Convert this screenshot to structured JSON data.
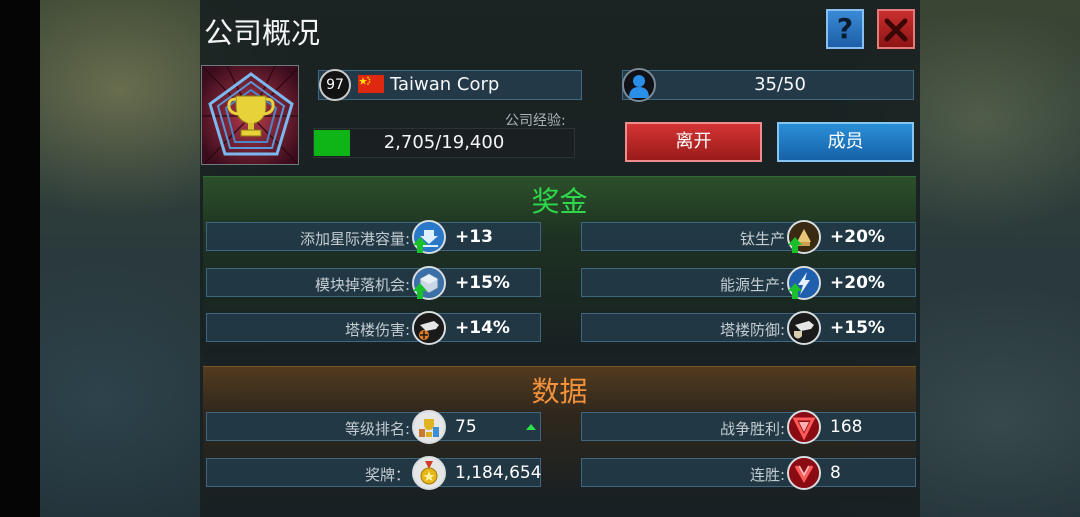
{
  "header": {
    "title": "公司概况",
    "help_label": "?"
  },
  "company": {
    "level": "97",
    "name": "Taiwan Corp",
    "exp_label": "公司经验:",
    "exp_text": "2,705/19,400",
    "exp_fraction": 0.139,
    "member_count": "35/50"
  },
  "actions": {
    "leave_label": "离开",
    "members_label": "成员"
  },
  "bonus": {
    "title": "奖金",
    "left": [
      {
        "label": "添加星际港容量:",
        "value": "+13",
        "icon": "starport-capacity-icon",
        "boost": true
      },
      {
        "label": "模块掉落机会:",
        "value": "+15%",
        "icon": "module-drop-icon",
        "boost": true
      },
      {
        "label": "塔楼伤害:",
        "value": "+14%",
        "icon": "tower-damage-icon",
        "boost": false
      }
    ],
    "right": [
      {
        "label": "钛生产",
        "value": "+20%",
        "icon": "titanium-icon",
        "boost": true
      },
      {
        "label": "能源生产:",
        "value": "+20%",
        "icon": "energy-icon",
        "boost": true
      },
      {
        "label": "塔楼防御:",
        "value": "+15%",
        "icon": "tower-defense-icon",
        "boost": false
      }
    ]
  },
  "stats": {
    "title": "数据",
    "left": [
      {
        "label": "等级排名:",
        "value": "75",
        "icon": "rank-trophy-icon"
      },
      {
        "label": "奖牌：",
        "value": "1,184,654",
        "icon": "medal-icon"
      }
    ],
    "right": [
      {
        "label": "战争胜利:",
        "value": "168",
        "icon": "war-wins-icon"
      },
      {
        "label": "连胜:",
        "value": "8",
        "icon": "win-streak-icon"
      }
    ]
  },
  "colors": {
    "accent_green": "#2fd84a",
    "accent_orange": "#f3923a",
    "leave_red": "#d43434",
    "members_blue": "#2a8fd8",
    "exp_green": "#0fb417"
  }
}
